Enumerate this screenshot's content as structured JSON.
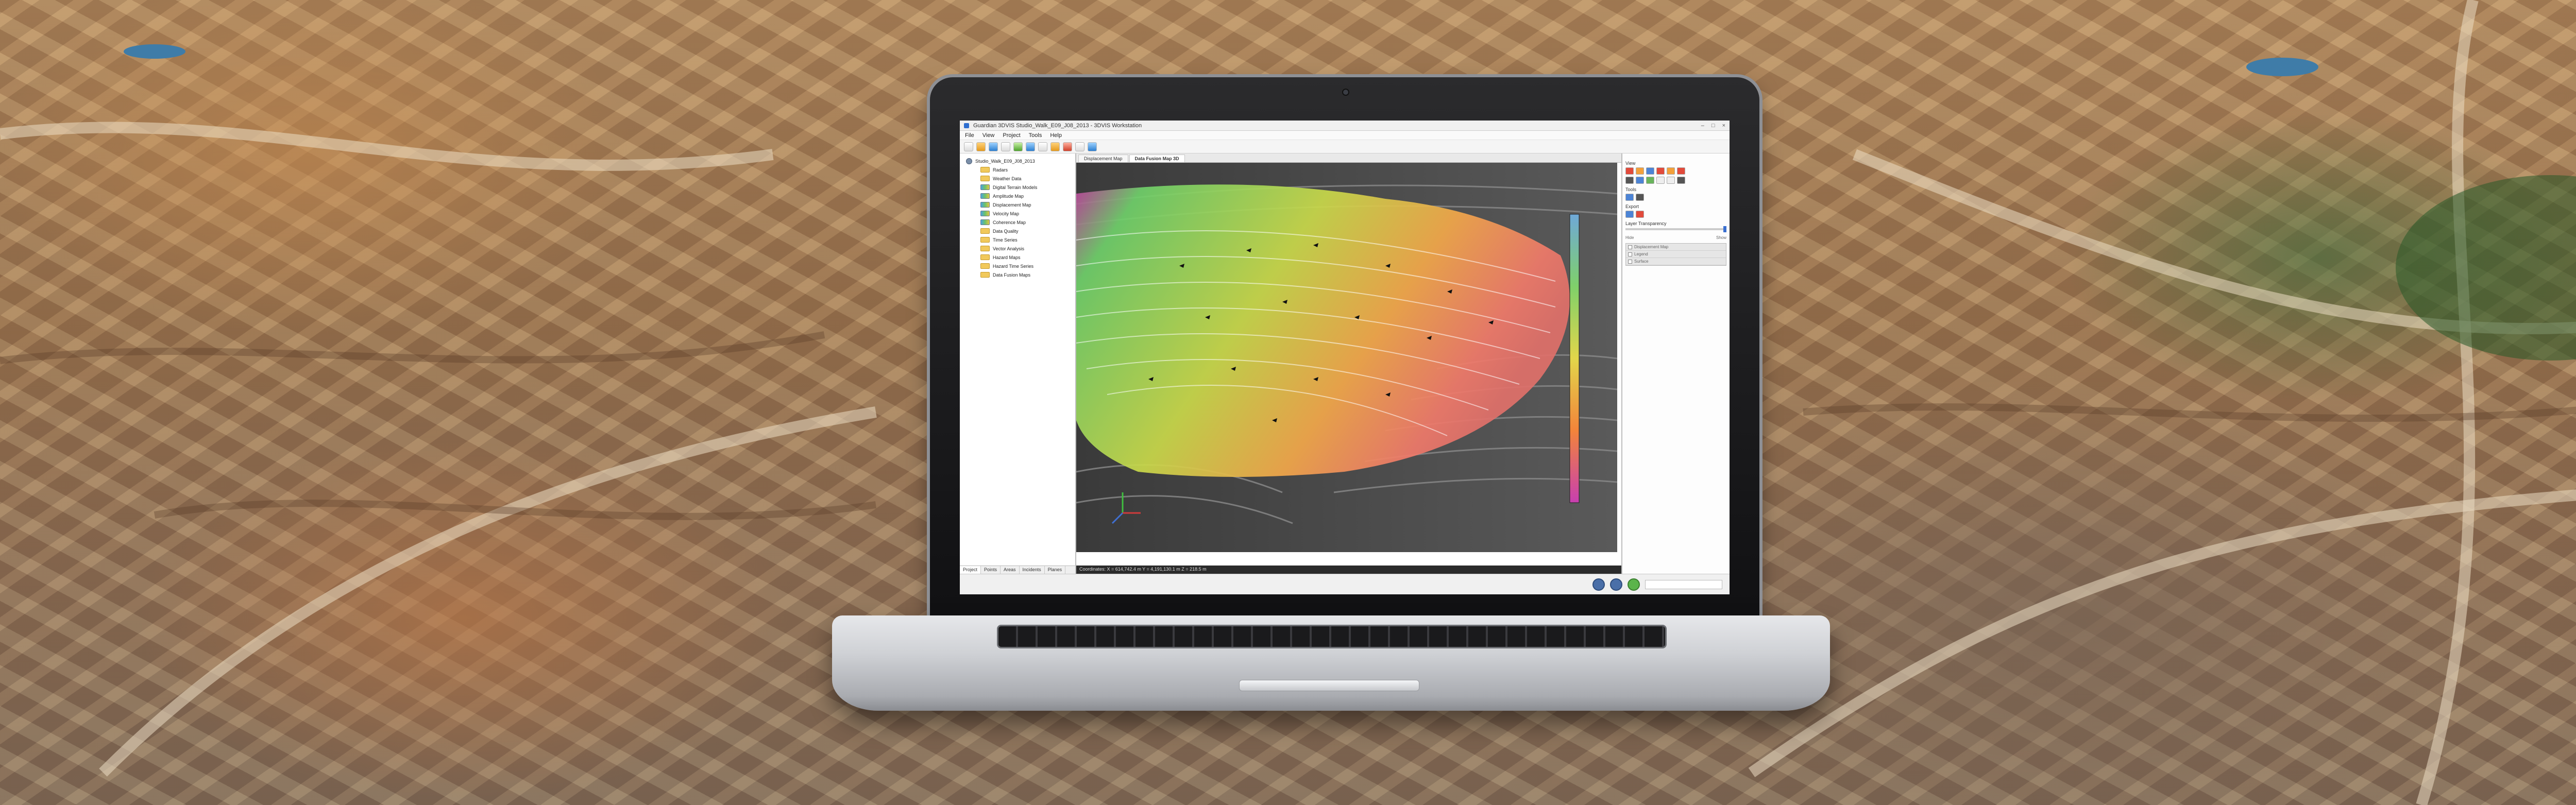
{
  "app": {
    "title": "Guardian 3DVIS Studio_Walk_E09_J08_2013 - 3DVIS Workstation",
    "window_controls": [
      "–",
      "□",
      "×"
    ]
  },
  "menu": [
    "File",
    "View",
    "Project",
    "Tools",
    "Help"
  ],
  "toolbar_icons": [
    "new-icon",
    "open-icon",
    "save-icon",
    "print-icon",
    "grid-icon",
    "layers-icon",
    "search-icon",
    "zoom-icon",
    "rotate-icon",
    "settings-icon",
    "info-icon"
  ],
  "tree": {
    "root": "Studio_Walk_E09_J08_2013",
    "items": [
      "Radars",
      "Weather Data",
      "Digital Terrain Models",
      "Amplitude Map",
      "Displacement Map",
      "Velocity Map",
      "Coherence Map",
      "Data Quality",
      "Time Series",
      "Vector Analysis",
      "Hazard Maps",
      "Hazard Time Series",
      "Data Fusion Maps"
    ],
    "tabs": [
      "Project",
      "Points",
      "Areas",
      "Incidents",
      "Planes"
    ]
  },
  "doc_tabs": [
    "Displacement Map",
    "Data Fusion Map 3D"
  ],
  "viewport": {
    "coordinates": "Coordinates: X = 614,742.4 m  Y = 4,191,130.1 m  Z = 218.5 m"
  },
  "properties": {
    "view_label": "View",
    "tools_label": "Tools",
    "export_label": "Export",
    "transparency_label": "Layer Transparency",
    "slider_min": "Hide",
    "slider_max": "Show",
    "layers": [
      "Displacement Map",
      "Legend",
      "Surface"
    ]
  }
}
